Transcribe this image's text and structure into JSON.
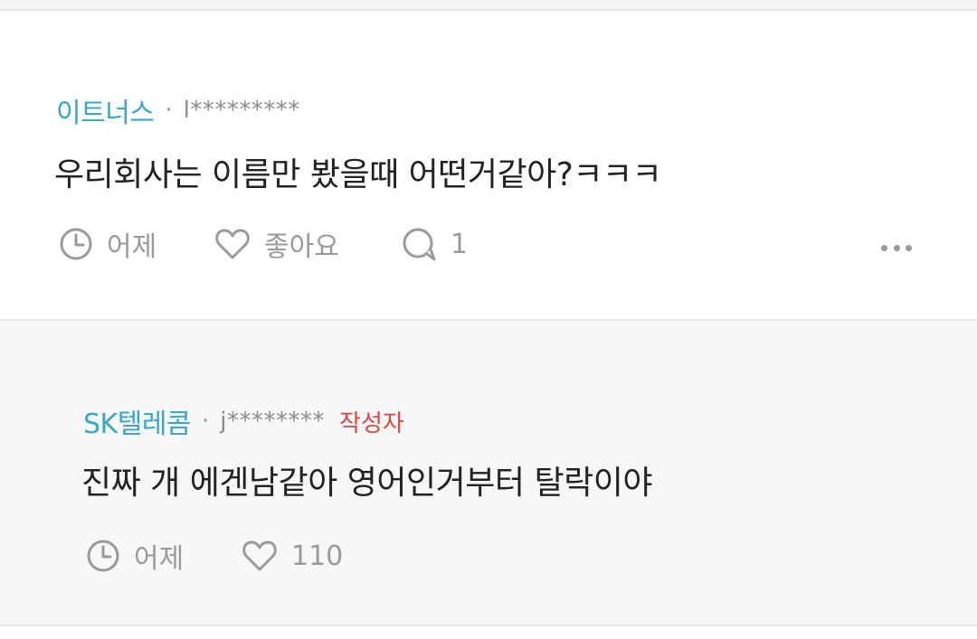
{
  "comments": [
    {
      "company": "이트너스",
      "separator": "·",
      "user_id": "l*********",
      "body": "우리회사는 이름만 봤을때 어떤거같아?ㅋㅋㅋ",
      "time": "어제",
      "like_label": "좋아요",
      "reply_count": "1"
    },
    {
      "company": "SK텔레콤",
      "separator": "·",
      "user_id": "j********",
      "author_badge": "작성자",
      "body": "진짜 개 에겐남같아 영어인거부터 탈락이야",
      "time": "어제",
      "like_count": "110"
    }
  ],
  "icons": {
    "time": "clock-icon",
    "like": "heart-icon",
    "reply": "speech-bubble-icon",
    "more": "more-horizontal-icon"
  },
  "colors": {
    "company_text": "#3aa7c7",
    "author_badge": "#d9473f",
    "muted_text": "#9a9a9a",
    "body_text": "#222222",
    "reply_background": "#f7f7f7"
  }
}
